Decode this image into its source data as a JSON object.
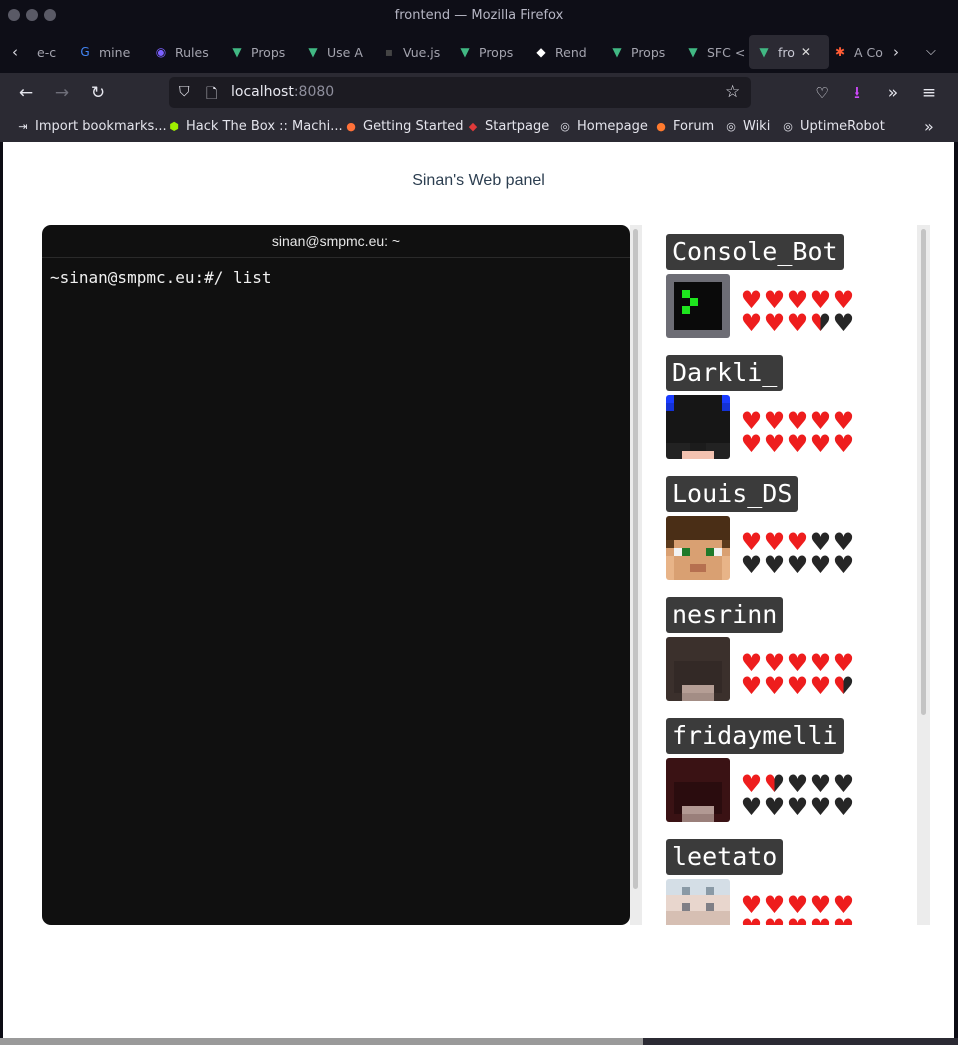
{
  "window": {
    "title": "frontend — Mozilla Firefox"
  },
  "tabs": [
    {
      "label": "e-c",
      "favicon": "generic-icon",
      "color": "#7b7b88"
    },
    {
      "label": "mine",
      "favicon": "google-icon",
      "color": "#4285f4"
    },
    {
      "label": "Rules",
      "favicon": "rules-icon",
      "color": "#7b61ff"
    },
    {
      "label": "Props",
      "favicon": "vue-icon",
      "color": "#41b883"
    },
    {
      "label": "Use A",
      "favicon": "vue-icon",
      "color": "#41b883"
    },
    {
      "label": "Vue.js",
      "favicon": "generic-icon",
      "color": "#444444"
    },
    {
      "label": "Props",
      "favicon": "vue-icon",
      "color": "#41b883"
    },
    {
      "label": "Rend",
      "favicon": "render-icon",
      "color": "#ffffff"
    },
    {
      "label": "Props",
      "favicon": "vue-icon",
      "color": "#41b883"
    },
    {
      "label": "SFC <",
      "favicon": "vue-icon",
      "color": "#41b883"
    },
    {
      "label": "fro",
      "favicon": "vue-icon",
      "color": "#41b883",
      "active": true
    },
    {
      "label": "A Co",
      "favicon": "asterisk-icon",
      "color": "#ff5c35"
    }
  ],
  "nav": {
    "url_host": "localhost",
    "url_port": ":8080"
  },
  "bookmarks": [
    {
      "label": "Import bookmarks...",
      "icon": "import-icon",
      "color": "#e4e4ec"
    },
    {
      "label": "Hack The Box :: Machi...",
      "icon": "htb-icon",
      "color": "#9fef00"
    },
    {
      "label": "Getting Started",
      "icon": "firefox-icon",
      "color": "#ff7139"
    },
    {
      "label": "Startpage",
      "icon": "startpage-icon",
      "color": "#e03a3a"
    },
    {
      "label": "Homepage",
      "icon": "globe-icon",
      "color": "#e4e4ec"
    },
    {
      "label": "Forum",
      "icon": "forum-icon",
      "color": "#ff7a2e"
    },
    {
      "label": "Wiki",
      "icon": "globe-icon",
      "color": "#e4e4ec"
    },
    {
      "label": "UptimeRobot",
      "icon": "globe-icon",
      "color": "#e4e4ec"
    }
  ],
  "page": {
    "title": "Sinan's Web panel",
    "terminal": {
      "header": "sinan@smpmc.eu: ~",
      "line": "~sinan@smpmc.eu:#/ list"
    },
    "players": [
      {
        "name": "Console_Bot",
        "health": 8.5,
        "max_health": 10,
        "avatar": "console"
      },
      {
        "name": "Darkli_",
        "health": 10,
        "max_health": 10,
        "avatar": "darkli"
      },
      {
        "name": "Louis_DS",
        "health": 3,
        "max_health": 10,
        "avatar": "louis"
      },
      {
        "name": "nesrinn",
        "health": 9.5,
        "max_health": 10,
        "avatar": "nesrinn"
      },
      {
        "name": "fridaymelli",
        "health": 1.5,
        "max_health": 10,
        "avatar": "friday"
      },
      {
        "name": "leetato",
        "health": 10,
        "max_health": 10,
        "avatar": "leetato"
      }
    ]
  }
}
